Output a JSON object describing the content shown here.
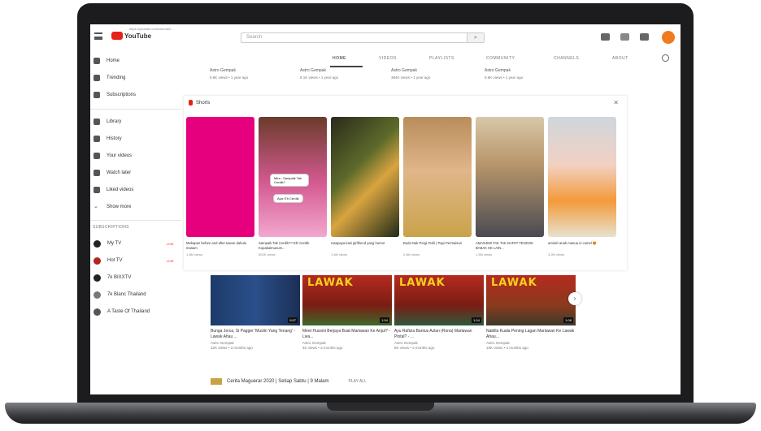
{
  "browser": {
    "url": "https://youtube.com/channel/..."
  },
  "topbar": {
    "logo_text": "YouTube",
    "search_placeholder": "Search"
  },
  "sidebar": {
    "items": [
      {
        "label": "Home",
        "icon": "home-icon"
      },
      {
        "label": "Trending",
        "icon": "fire-icon"
      },
      {
        "label": "Subscriptions",
        "icon": "subscriptions-icon"
      },
      {
        "label": "Library",
        "icon": "library-icon"
      },
      {
        "label": "History",
        "icon": "history-icon"
      },
      {
        "label": "Your videos",
        "icon": "video-icon"
      },
      {
        "label": "Watch later",
        "icon": "clock-icon"
      },
      {
        "label": "Liked videos",
        "icon": "thumb-up-icon"
      },
      {
        "label": "Show more",
        "icon": "chevron-down-icon"
      }
    ],
    "subscriptions_header": "SUBSCRIPTIONS",
    "subscriptions": [
      {
        "label": "My TV",
        "live": "LIVE"
      },
      {
        "label": "Hot TV",
        "live": "LIVE"
      },
      {
        "label": "7k BIXXTV",
        "live": ""
      },
      {
        "label": "7k Blanc Thailand",
        "live": ""
      },
      {
        "label": "A Taste Of Thailand",
        "live": ""
      }
    ]
  },
  "tabs": [
    "HOME",
    "VIDEOS",
    "PLAYLISTS",
    "COMMUNITY",
    "CHANNELS",
    "ABOUT"
  ],
  "top_row": [
    {
      "channel": "Astro Gempak",
      "stats": "8.9K views • 1 year ago"
    },
    {
      "channel": "Astro Gempak",
      "stats": "8.1K views • 1 year ago"
    },
    {
      "channel": "Astro Gempak",
      "stats": "384K views • 1 year ago"
    },
    {
      "channel": "Astro Gempak",
      "stats": "8.6K views • 1 year ago"
    }
  ],
  "shorts": {
    "title": "Shorts",
    "items": [
      {
        "title": "Mekapan before and after tawon dahulu masam",
        "views": "1.8M views"
      },
      {
        "title": "Sampaik Tak Cerdik?? Ehi Cerdik Kupakalmunum...",
        "views": "502K views",
        "bubble1": "Mira : Sampaik Tak Cerdik?",
        "bubble2": "Aya: Eh Cerdik"
      },
      {
        "title": "rasapaya kasi girlfriend yang humor",
        "views": "1.4M views"
      },
      {
        "title": "Buda Nak Pergi Terili | Papi Permaisuri",
        "views": "2.6M views"
      },
      {
        "title": "AMANJIMI TAK TAK DAPAT TENGOK BABAK KE LAIN...",
        "views": "1.5M views"
      },
      {
        "title": "amirah anak manua ni comel 😍",
        "views": "3.2M views"
      }
    ]
  },
  "videos": [
    {
      "title": "Bunga Jerus, Si Pagger 'Muslin Yang Tenang' - Lawak Ahau ...",
      "channel": "Astro Gempak",
      "stats": "32K views • 3 months ago",
      "duration": "9:57",
      "overlay": ""
    },
    {
      "title": "Meet Hussini Berjaya Buat Marlawan Ke Anjut? - Lwa...",
      "channel": "Astro Gempak",
      "stats": "4K views • 3 months ago",
      "duration": "1:54",
      "overlay": "LAWAK"
    },
    {
      "title": "Ayu Rafizia Bantus Azlan (Rona) Marlawan Pintal? - ...",
      "channel": "Astro Gempak",
      "stats": "6K views • 3 months ago",
      "duration": "1:04",
      "overlay": "LAWAK"
    },
    {
      "title": "Nabilla Kuala Pening Lagan Marlawan Ke Lawak Ahau...",
      "channel": "Astro Gempak",
      "stats": "18K views • 4 months ago",
      "duration": "1:08",
      "overlay": "LAWAK"
    }
  ],
  "bottom_section": {
    "title": "Cerita Maguerar 2020 | Setiap Sabtu | 9 Malam",
    "play_all": "PLAY ALL"
  }
}
